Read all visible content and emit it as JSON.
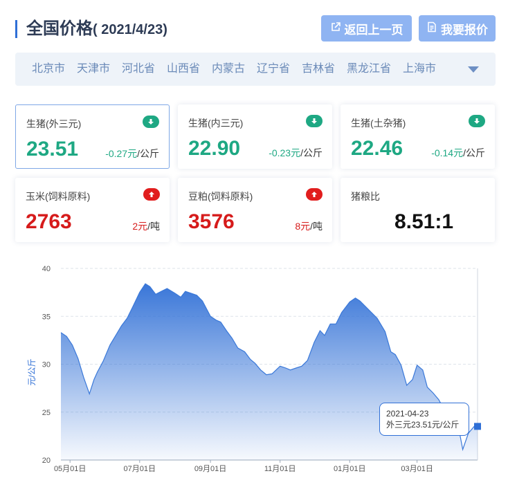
{
  "header": {
    "title": "全国价格",
    "date": "( 2021/4/23)",
    "back_button": "返回上一页",
    "quote_button": "我要报价"
  },
  "regions": {
    "items": [
      "北京市",
      "天津市",
      "河北省",
      "山西省",
      "内蒙古",
      "辽宁省",
      "吉林省",
      "黑龙江省",
      "上海市"
    ]
  },
  "cards": [
    {
      "label": "生猪(外三元)",
      "value": "23.51",
      "change": "-0.27元",
      "unit": "/公斤",
      "trend": "down"
    },
    {
      "label": "生猪(内三元)",
      "value": "22.90",
      "change": "-0.23元",
      "unit": "/公斤",
      "trend": "down"
    },
    {
      "label": "生猪(土杂猪)",
      "value": "22.46",
      "change": "-0.14元",
      "unit": "/公斤",
      "trend": "down"
    },
    {
      "label": "玉米(饲料原料)",
      "value": "2763",
      "change": "2元",
      "unit": "/吨",
      "trend": "up"
    },
    {
      "label": "豆粕(饲料原料)",
      "value": "3576",
      "change": "8元",
      "unit": "/吨",
      "trend": "up"
    },
    {
      "label": "猪粮比",
      "value": "8.51:1"
    }
  ],
  "colors": {
    "down": "#1ea883",
    "up": "#d61b1b",
    "accent": "#2f6fd6",
    "button": "#8fb4f2"
  },
  "tooltip": {
    "date": "2021-04-23",
    "text": "外三元23.51元/公斤"
  },
  "chart_data": {
    "type": "area",
    "ylabel": "元/公斤",
    "ylim": [
      20,
      40
    ],
    "yticks": [
      20,
      25,
      30,
      35,
      40
    ],
    "xticks": [
      "05月01日",
      "07月01日",
      "09月01日",
      "11月01日",
      "01月01日",
      "03月01日"
    ],
    "grid": true,
    "x": [
      "2020-04-23",
      "2020-04-28",
      "2020-05-03",
      "2020-05-08",
      "2020-05-13",
      "2020-05-18",
      "2020-05-22",
      "2020-05-25",
      "2020-05-30",
      "2020-06-05",
      "2020-06-10",
      "2020-06-15",
      "2020-06-20",
      "2020-06-25",
      "2020-07-01",
      "2020-07-06",
      "2020-07-10",
      "2020-07-15",
      "2020-07-20",
      "2020-07-25",
      "2020-08-01",
      "2020-08-06",
      "2020-08-10",
      "2020-08-15",
      "2020-08-20",
      "2020-08-25",
      "2020-09-01",
      "2020-09-06",
      "2020-09-10",
      "2020-09-15",
      "2020-09-20",
      "2020-09-25",
      "2020-10-01",
      "2020-10-06",
      "2020-10-10",
      "2020-10-15",
      "2020-10-20",
      "2020-10-25",
      "2020-11-01",
      "2020-11-06",
      "2020-11-10",
      "2020-11-15",
      "2020-11-20",
      "2020-11-25",
      "2020-12-01",
      "2020-12-06",
      "2020-12-10",
      "2020-12-15",
      "2020-12-20",
      "2020-12-25",
      "2021-01-01",
      "2021-01-06",
      "2021-01-10",
      "2021-01-15",
      "2021-01-20",
      "2021-01-25",
      "2021-02-01",
      "2021-02-06",
      "2021-02-10",
      "2021-02-15",
      "2021-02-20",
      "2021-02-25",
      "2021-03-01",
      "2021-03-06",
      "2021-03-10",
      "2021-03-15",
      "2021-03-20",
      "2021-03-25",
      "2021-04-01",
      "2021-04-06",
      "2021-04-10",
      "2021-04-15",
      "2021-04-20",
      "2021-04-23"
    ],
    "series": [
      {
        "values": [
          33.3,
          32.9,
          32.0,
          30.6,
          28.6,
          26.9,
          28.4,
          29.2,
          30.3,
          32.0,
          33.0,
          34.0,
          34.8,
          36.0,
          37.5,
          38.4,
          38.1,
          37.3,
          37.6,
          37.9,
          37.4,
          37.0,
          37.6,
          37.4,
          37.2,
          36.6,
          35.0,
          34.6,
          34.4,
          33.5,
          32.7,
          31.7,
          31.3,
          30.5,
          30.1,
          29.4,
          28.9,
          29.0,
          29.8,
          29.6,
          29.4,
          29.6,
          29.8,
          30.4,
          32.3,
          33.5,
          33.0,
          34.2,
          34.2,
          35.4,
          36.5,
          36.9,
          36.6,
          36.0,
          35.4,
          34.8,
          33.4,
          31.3,
          31.0,
          29.9,
          27.8,
          28.4,
          29.9,
          29.4,
          27.6,
          27.0,
          26.3,
          25.2,
          24.1,
          23.6,
          21.1,
          22.8,
          23.5,
          23.51
        ]
      }
    ],
    "highlight": {
      "date": "2021-04-23",
      "value": 23.51
    }
  }
}
